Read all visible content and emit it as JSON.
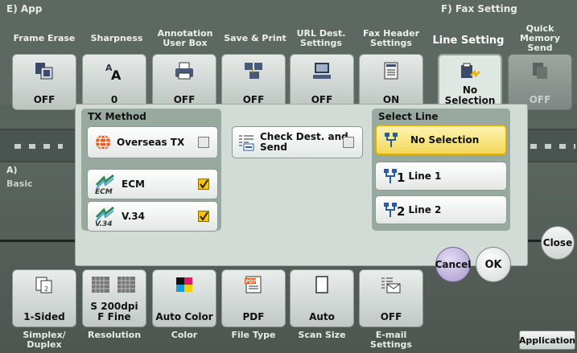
{
  "sections": {
    "app": "E)  App",
    "fax": "F)  Fax Setting",
    "basic_prefix": "A)",
    "basic": "Basic"
  },
  "top_tabs": [
    {
      "label": "Frame Erase",
      "value": "OFF",
      "icon": "frame-erase-icon"
    },
    {
      "label": "Sharpness",
      "value": "0",
      "icon": "sharpness-icon"
    },
    {
      "label": "Annotation\nUser Box",
      "value": "OFF",
      "icon": "printer-icon"
    },
    {
      "label": "Save & Print",
      "value": "OFF",
      "icon": "save-print-icon"
    },
    {
      "label": "URL Dest.\nSettings",
      "value": "OFF",
      "icon": "computer-icon"
    },
    {
      "label": "Fax Header\nSettings",
      "value": "ON",
      "icon": "document-icon"
    },
    {
      "label": "Line Setting",
      "value": "No\nSelection",
      "icon": "fax-line-icon"
    },
    {
      "label": "Quick\nMemory Send",
      "value": "OFF",
      "icon": "memory-send-icon"
    }
  ],
  "dialog": {
    "tx_method": "TX Method",
    "overseas": "Overseas TX",
    "check_dest": "Check Dest. and\nSend",
    "ecm": "ECM",
    "ecm_icon_text": "ECM",
    "v34": "V.34",
    "v34_icon_text": "V.34",
    "select_line": "Select Line",
    "no_selection": "No Selection",
    "line1": "Line 1",
    "line1_sub": "1",
    "line2": "Line 2",
    "line2_sub": "2",
    "cancel": "Cancel",
    "ok": "OK"
  },
  "close": "Close",
  "bottom_tabs": [
    {
      "value": "1-Sided",
      "label": "Simplex/\nDuplex",
      "icon": "simplex-duplex-icon"
    },
    {
      "value": "S 200dpi\nF Fine",
      "label": "Resolution",
      "icon": "resolution-icon"
    },
    {
      "value": "Auto Color",
      "label": "Color",
      "icon": "color-icon"
    },
    {
      "value": "PDF",
      "label": "File Type",
      "icon": "pdf-icon"
    },
    {
      "value": "Auto",
      "label": "Scan Size",
      "icon": "scan-size-icon"
    },
    {
      "value": "OFF",
      "label": "E-mail\nSettings",
      "icon": "email-icon"
    }
  ],
  "application": "Application",
  "colors": {
    "accent_yellow": "#f4c30a",
    "dialog_bg": "#d3dbd7",
    "group_bg": "#98aaa0",
    "purple": "#b8a8d8"
  }
}
